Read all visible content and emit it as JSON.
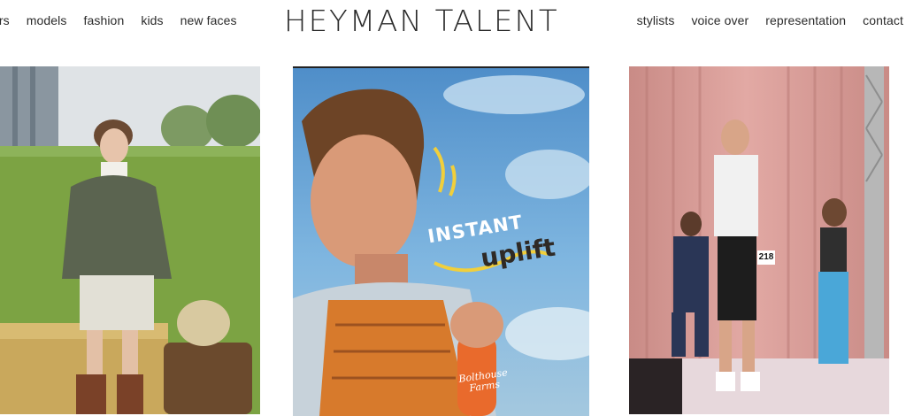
{
  "nav_left": [
    "ors",
    "models",
    "fashion",
    "kids",
    "new faces"
  ],
  "logo": "HEYMAN TALENT",
  "nav_right": [
    "stylists",
    "voice over",
    "representation",
    "contact"
  ],
  "photos": [
    {
      "alt": "girl in quilted jacket standing in a field"
    },
    {
      "alt": "man smiling holding juice bottle",
      "cta_line1": "INSTANT",
      "cta_line2": "uplift",
      "bottle_label": "Bolthouse Farms"
    },
    {
      "alt": "children on a fashion runway",
      "bib_number": "218"
    }
  ],
  "colors": {
    "text": "#2a2a2a",
    "background": "#ffffff"
  }
}
